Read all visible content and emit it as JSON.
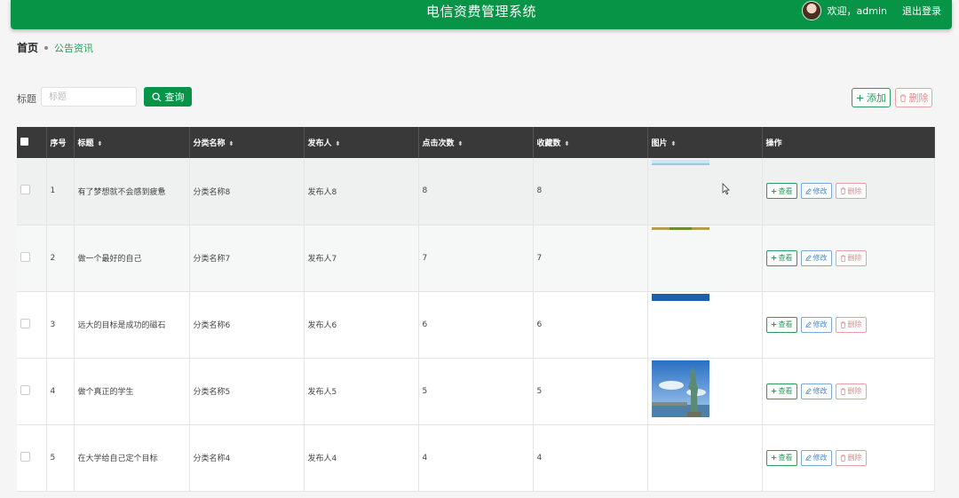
{
  "header": {
    "app_title": "电信资费管理系统",
    "welcome": "欢迎，admin",
    "logout": "退出登录"
  },
  "breadcrumb": {
    "home": "首页",
    "current": "公告资讯"
  },
  "search": {
    "label": "标题",
    "placeholder": "标题",
    "button": "查询"
  },
  "toolbar": {
    "add": "添加",
    "delete": "删除"
  },
  "table": {
    "columns": [
      "序号",
      "标题",
      "分类名称",
      "发布人",
      "点击次数",
      "收藏数",
      "图片",
      "操作"
    ],
    "rows": [
      {
        "no": "1",
        "title": "有了梦想就不会感到疲惫",
        "category": "分类名称8",
        "publisher": "发布人8",
        "clicks": "8",
        "favorites": "8",
        "image": "sky-strip"
      },
      {
        "no": "2",
        "title": "做一个最好的自己",
        "category": "分类名称7",
        "publisher": "发布人7",
        "clicks": "7",
        "favorites": "7",
        "image": "field-strip"
      },
      {
        "no": "3",
        "title": "远大的目标是成功的磁石",
        "category": "分类名称6",
        "publisher": "发布人6",
        "clicks": "6",
        "favorites": "6",
        "image": "blue-strip"
      },
      {
        "no": "4",
        "title": "做个真正的学生",
        "category": "分类名称5",
        "publisher": "发布人5",
        "clicks": "5",
        "favorites": "5",
        "image": "statue-photo"
      },
      {
        "no": "5",
        "title": "在大学给自己定个目标",
        "category": "分类名称4",
        "publisher": "发布人4",
        "clicks": "4",
        "favorites": "4",
        "image": ""
      }
    ],
    "actions": {
      "view": "查看",
      "edit": "修改",
      "delete": "删除"
    }
  },
  "colors": {
    "primary": "#089447",
    "header_row": "#393939",
    "edit": "#4a86c5",
    "danger": "#e08a8a"
  }
}
